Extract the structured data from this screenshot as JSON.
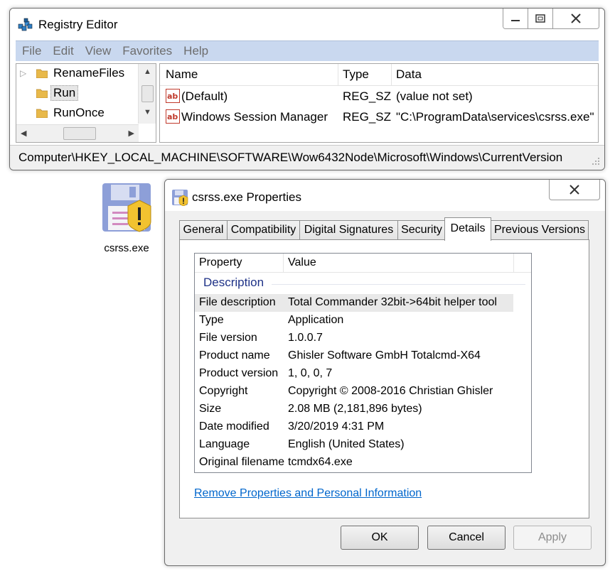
{
  "registry": {
    "title": "Registry Editor",
    "menu": [
      "File",
      "Edit",
      "View",
      "Favorites",
      "Help"
    ],
    "tree_items": [
      {
        "label": "RenameFiles",
        "selected": false
      },
      {
        "label": "Run",
        "selected": true
      },
      {
        "label": "RunOnce",
        "selected": false
      }
    ],
    "columns": {
      "name": "Name",
      "type": "Type",
      "data": "Data"
    },
    "values": [
      {
        "name": "(Default)",
        "type": "REG_SZ",
        "data": "(value not set)"
      },
      {
        "name": "Windows Session Manager",
        "type": "REG_SZ",
        "data": "\"C:\\ProgramData\\services\\csrss.exe\""
      }
    ],
    "status_path": "Computer\\HKEY_LOCAL_MACHINE\\SOFTWARE\\Wow6432Node\\Microsoft\\Windows\\CurrentVersion"
  },
  "desktop_icon": {
    "label": "csrss.exe"
  },
  "properties": {
    "title": "csrss.exe Properties",
    "tabs": [
      "General",
      "Compatibility",
      "Digital Signatures",
      "Security",
      "Details",
      "Previous Versions"
    ],
    "active_tab": "Details",
    "columns": {
      "property": "Property",
      "value": "Value"
    },
    "group": "Description",
    "rows": [
      {
        "key": "File description",
        "value": "Total Commander 32bit->64bit helper tool"
      },
      {
        "key": "Type",
        "value": "Application"
      },
      {
        "key": "File version",
        "value": "1.0.0.7"
      },
      {
        "key": "Product name",
        "value": "Ghisler Software GmbH Totalcmd-X64"
      },
      {
        "key": "Product version",
        "value": "1, 0, 0, 7"
      },
      {
        "key": "Copyright",
        "value": "Copyright © 2008-2016 Christian Ghisler"
      },
      {
        "key": "Size",
        "value": "2.08 MB (2,181,896 bytes)"
      },
      {
        "key": "Date modified",
        "value": "3/20/2019 4:31 PM"
      },
      {
        "key": "Language",
        "value": "English (United States)"
      },
      {
        "key": "Original filename",
        "value": "tcmdx64.exe"
      }
    ],
    "link": "Remove Properties and Personal Information",
    "buttons": {
      "ok": "OK",
      "cancel": "Cancel",
      "apply": "Apply"
    }
  },
  "colors": {
    "menubar": "#c9d8ef",
    "link": "#0066cc",
    "group_label": "#1e3287"
  }
}
